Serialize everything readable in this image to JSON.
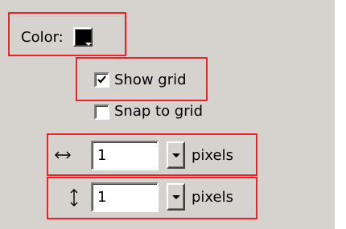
{
  "color_row": {
    "label": "Color:",
    "swatch_color": "#000000"
  },
  "show_grid": {
    "label": "Show grid",
    "checked": true
  },
  "snap_to_grid": {
    "label": "Snap to grid",
    "checked": false
  },
  "horizontal_spacing": {
    "icon": "horizontal-arrows-icon",
    "value": "1",
    "unit": "pixels"
  },
  "vertical_spacing": {
    "icon": "vertical-arrows-icon",
    "value": "1",
    "unit": "pixels"
  },
  "highlight_color": "#e8232a"
}
